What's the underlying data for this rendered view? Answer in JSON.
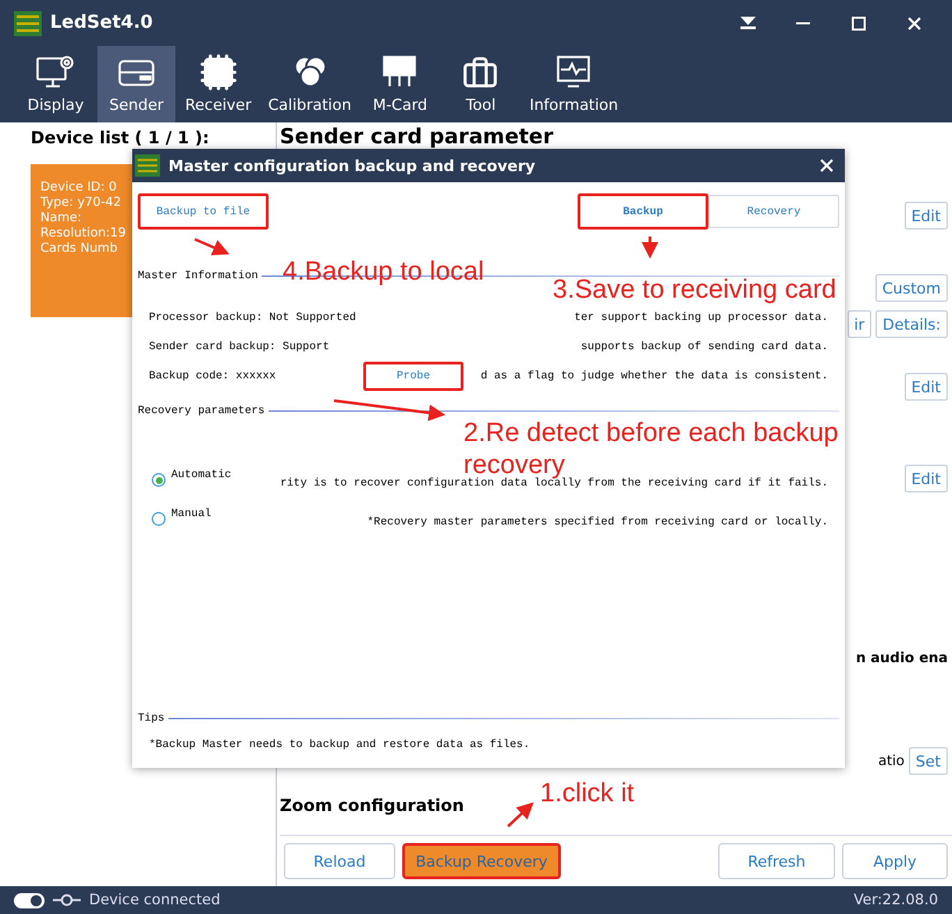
{
  "window": {
    "title": "LedSet4.0"
  },
  "toolbar": [
    {
      "label": "Display",
      "selected": false
    },
    {
      "label": "Sender",
      "selected": true
    },
    {
      "label": "Receiver",
      "selected": false
    },
    {
      "label": "Calibration",
      "selected": false
    },
    {
      "label": "M-Card",
      "selected": false
    },
    {
      "label": "Tool",
      "selected": false
    },
    {
      "label": "Information",
      "selected": false
    }
  ],
  "device_list": {
    "title": "Device list ( 1 / 1 ):",
    "card_lines": [
      "Device ID: 0",
      "Type: y70-42",
      "Name:",
      "Resolution:19",
      "Cards Numb"
    ]
  },
  "sender_panel": {
    "title": "Sender card parameter",
    "side_items": [
      {
        "kind": "button",
        "label": "Edit"
      },
      {
        "kind": "button",
        "label": "Custom"
      },
      {
        "kind": "button-pair",
        "labels": [
          "ir",
          "Details:"
        ]
      },
      {
        "kind": "button",
        "label": "Edit"
      },
      {
        "kind": "button",
        "label": "Edit"
      },
      {
        "kind": "text",
        "label": "n audio ena"
      },
      {
        "kind": "text-button",
        "text": "atio",
        "label": "Set"
      }
    ],
    "zoom_title": "Zoom configuration",
    "buttons": [
      {
        "label": "Reload",
        "selected": false,
        "highlighted": false
      },
      {
        "label": "Backup Recovery",
        "selected": true,
        "highlighted": true
      },
      {
        "label": "Refresh",
        "selected": false,
        "highlighted": false
      },
      {
        "label": "Apply",
        "selected": false,
        "highlighted": false
      }
    ]
  },
  "dialog": {
    "title": "Master configuration backup and recovery",
    "backup_to_file": {
      "label": "Backup to file",
      "highlighted": true
    },
    "tabs": [
      {
        "label": "Backup",
        "selected": true,
        "highlighted": true
      },
      {
        "label": "Recovery",
        "selected": false,
        "highlighted": false
      }
    ],
    "master_information": {
      "title": "Master Information",
      "rows": [
        {
          "label": "Processor backup: Not Supported",
          "note": "ter support backing up processor data."
        },
        {
          "label": "Sender card backup: Support",
          "note": "supports backup of sending card data."
        },
        {
          "label": "Backup code: xxxxxx",
          "note": "d as a flag to judge whether the data is consistent."
        }
      ],
      "probe": {
        "label": "Probe",
        "highlighted": true
      }
    },
    "recovery_parameters": {
      "title": "Recovery parameters",
      "options": [
        {
          "label": "Automatic",
          "selected": true,
          "note": "rity is to recover configuration data locally from the receiving card if it fails."
        },
        {
          "label": "Manual",
          "selected": false,
          "note": "*Recovery master parameters specified from receiving card or locally."
        }
      ]
    },
    "tips": {
      "title": "Tips",
      "text": "*Backup Master needs to backup and restore data as files."
    }
  },
  "annotations": [
    {
      "text": "4.Backup to local"
    },
    {
      "text": "3.Save to receiving card"
    },
    {
      "text": "2.Re detect before each backup recovery"
    },
    {
      "text": "1.click it"
    }
  ],
  "status_bar": {
    "status": "Device connected",
    "version": "Ver:22.08.0"
  }
}
